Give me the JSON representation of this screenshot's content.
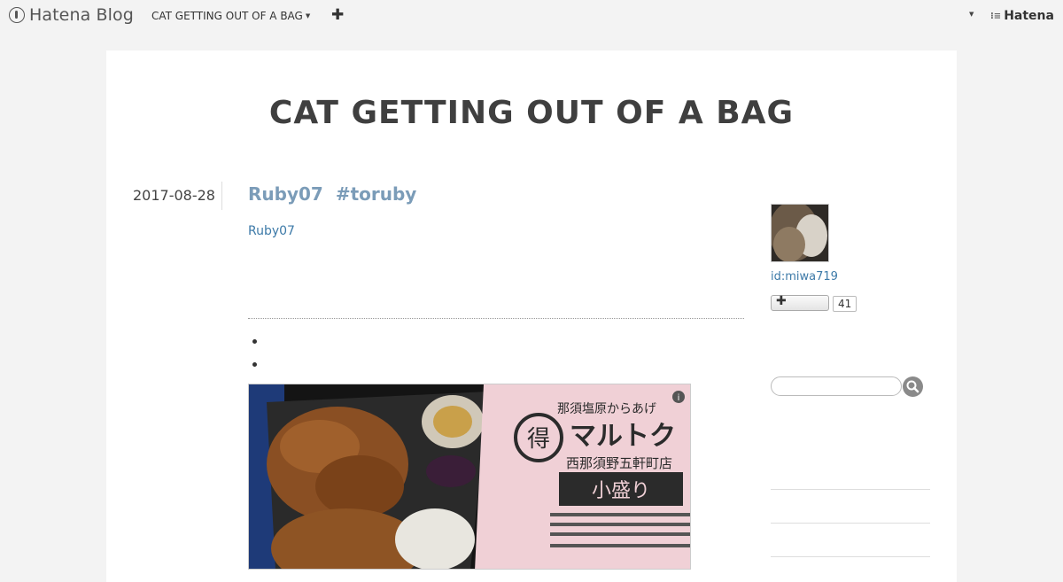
{
  "topbar": {
    "logo_text": "Hatena Blog",
    "blog_selector": "CAT GETTING OUT OF A BAG",
    "hatena_brand": "Hatena"
  },
  "blog": {
    "title": "CAT GETTING OUT OF A BAG"
  },
  "entry": {
    "date": "2017-08-28",
    "title_main": "Ruby07",
    "title_tag": "#toruby",
    "category_link": "Ruby07",
    "bullets": [
      "",
      ""
    ],
    "photo": {
      "kanji_badge": "得",
      "shop_name": "マルトク",
      "shop_sub": "那須塩原からあげ",
      "branch": "西那須野五軒町店",
      "label": "小盛り",
      "info_icon": "info-icon"
    }
  },
  "sidebar": {
    "user_id": "id:miwa719",
    "follow_count": "41",
    "search_placeholder": ""
  },
  "colors": {
    "accent_link": "#3d7aa8",
    "title_link": "#7b9cb8",
    "page_bg": "#f3f3f3"
  }
}
